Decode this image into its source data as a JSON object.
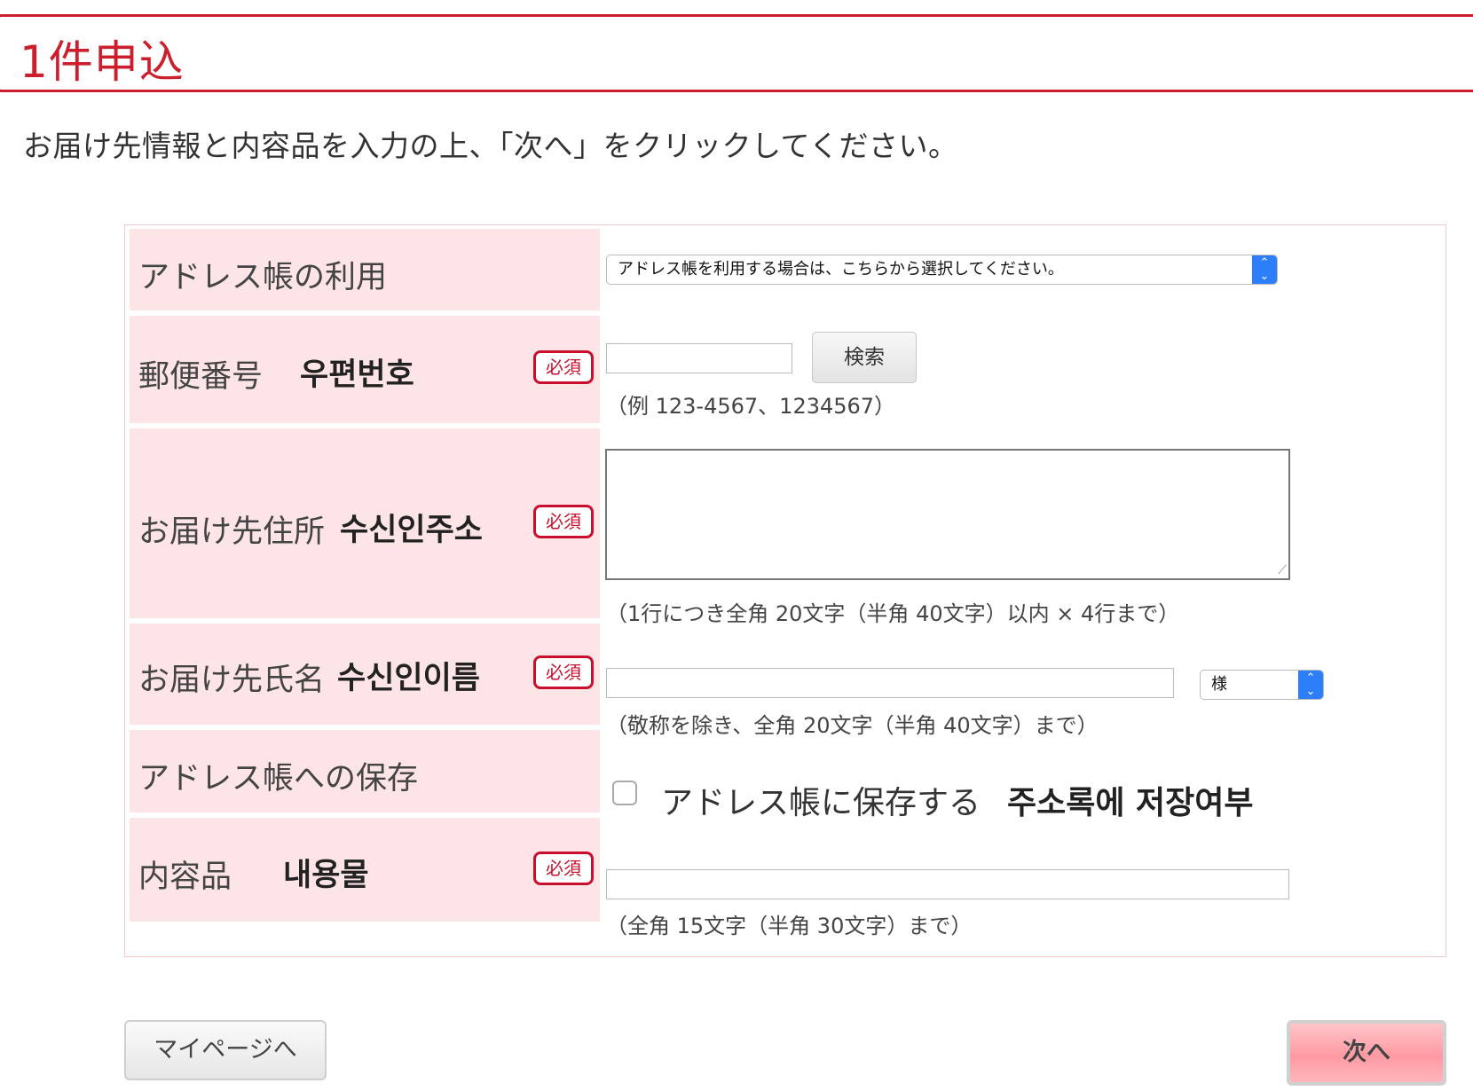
{
  "page": {
    "title": "1件申込",
    "instruction": "お届け先情報と内容品を入力の上、「次へ」をクリックしてください。"
  },
  "form": {
    "required_badge": "必須",
    "address_book": {
      "label": "アドレス帳の利用",
      "select_value": "アドレス帳を利用する場合は、こちらから選択してください。"
    },
    "postal_code": {
      "label_jp": "郵便番号",
      "label_ko": "우편번호",
      "value": "",
      "search_label": "検索",
      "hint": "（例 123-4567、1234567）"
    },
    "address": {
      "label_jp": "お届け先住所",
      "label_ko": "수신인주소",
      "value": "",
      "hint": "（1行につき全角 20文字（半角 40文字）以内 × 4行まで）"
    },
    "name": {
      "label_jp": "お届け先氏名",
      "label_ko": "수신인이름",
      "value": "",
      "honorific_value": "様",
      "hint": "（敬称を除き、全角 20文字（半角 40文字）まで）"
    },
    "save_to_address_book": {
      "label": "アドレス帳への保存",
      "checkbox_label": "アドレス帳に保存する",
      "checkbox_label_ko": "주소록에 저장여부",
      "checked": false
    },
    "contents": {
      "label_jp": "内容品",
      "label_ko": "내용물",
      "value": "",
      "hint": "（全角 15文字（半角 30文字）まで）"
    }
  },
  "footer": {
    "mypage_label": "マイページへ",
    "next_label": "次へ"
  },
  "colors": {
    "accent": "#cc1f2d",
    "label_bg": "#fde4e6",
    "select_arrow": "#2d7ff9"
  }
}
